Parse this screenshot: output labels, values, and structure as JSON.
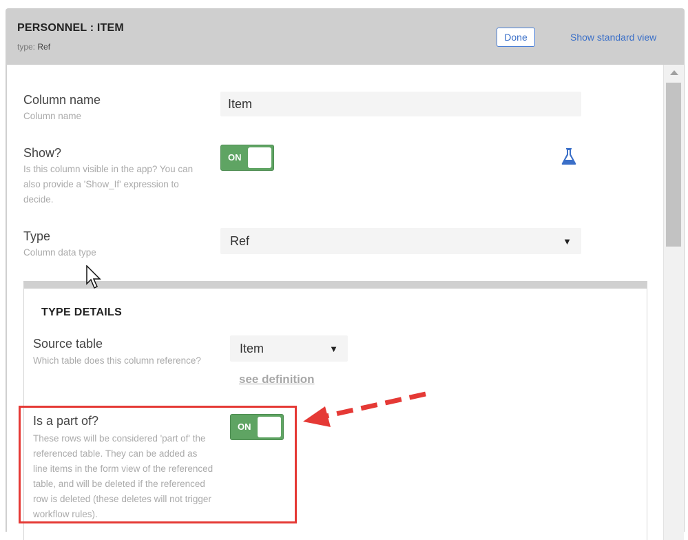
{
  "header": {
    "title": "PERSONNEL : ITEM",
    "type_prefix": "type: ",
    "type_value": "Ref",
    "done_label": "Done",
    "standard_view_label": "Show standard view"
  },
  "fields": {
    "column_name": {
      "label": "Column name",
      "hint": "Column name",
      "value": "Item"
    },
    "show": {
      "label": "Show?",
      "hint": "Is this column visible in the app? You can also provide a 'Show_If' expression to decide.",
      "toggle": "ON"
    },
    "type": {
      "label": "Type",
      "hint": "Column data type",
      "value": "Ref"
    }
  },
  "type_details": {
    "title": "TYPE DETAILS",
    "source_table": {
      "label": "Source table",
      "hint": "Which table does this column reference?",
      "value": "Item",
      "link": "see definition"
    },
    "is_part_of": {
      "label": "Is a part of?",
      "hint": "These rows will be considered 'part of' the referenced table. They can be added as line items in the form view of the referenced table, and will be deleted if the referenced row is deleted (these deletes will not trigger workflow rules).",
      "toggle": "ON"
    }
  },
  "icons": {
    "flask": "flask-icon",
    "caret": "caret-down-icon",
    "scroll_up": "scroll-up-arrow-icon",
    "cursor": "mouse-pointer-icon",
    "annotation_arrow": "dashed-arrow-icon"
  },
  "colors": {
    "accent_blue": "#3a6fc8",
    "toggle_green": "#5fa463",
    "highlight_red": "#e53935",
    "header_gray": "#cfcfcf"
  }
}
